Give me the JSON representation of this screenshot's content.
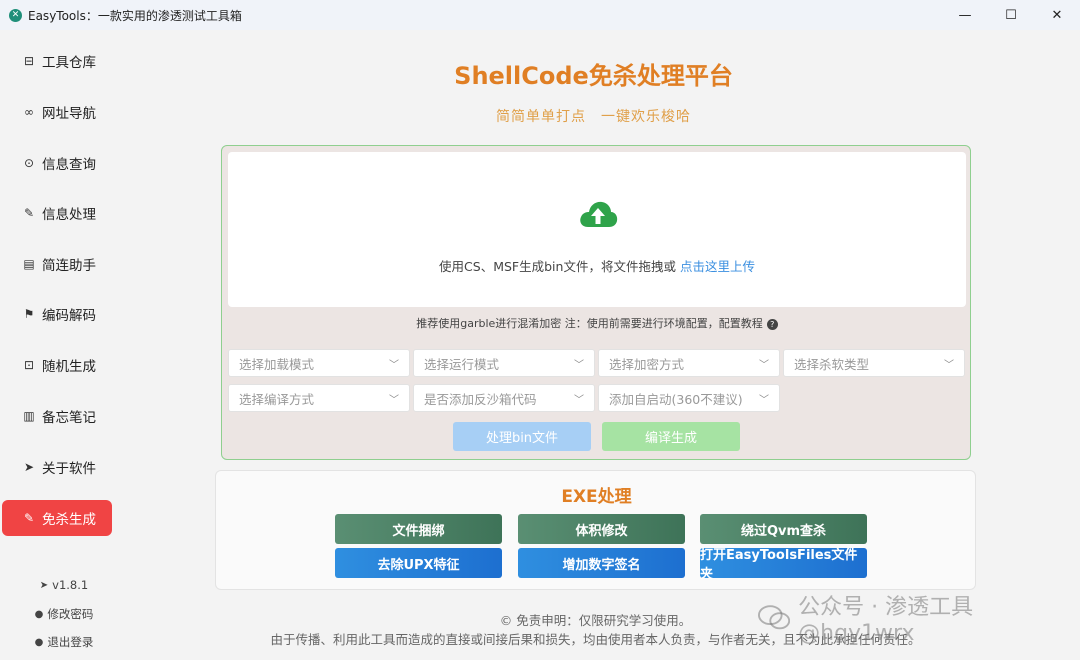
{
  "window": {
    "title": "EasyTools：一款实用的渗透测试工具箱",
    "minimize": "—",
    "maximize": "☐",
    "close": "✕"
  },
  "sidebar": {
    "items": [
      {
        "label": "工具仓库",
        "icon": "toolbox-icon",
        "glyph": "⊟"
      },
      {
        "label": "网址导航",
        "icon": "link-icon",
        "glyph": "∞"
      },
      {
        "label": "信息查询",
        "icon": "search-info-icon",
        "glyph": "⊙"
      },
      {
        "label": "信息处理",
        "icon": "edit-icon",
        "glyph": "✎"
      },
      {
        "label": "简连助手",
        "icon": "clipboard-icon",
        "glyph": "▤"
      },
      {
        "label": "编码解码",
        "icon": "flag-icon",
        "glyph": "⚑"
      },
      {
        "label": "随机生成",
        "icon": "gift-icon",
        "glyph": "⊡"
      },
      {
        "label": "备忘笔记",
        "icon": "notebook-icon",
        "glyph": "▥"
      },
      {
        "label": "关于软件",
        "icon": "send-icon",
        "glyph": "➤"
      },
      {
        "label": "免杀生成",
        "icon": "bug-icon",
        "glyph": "✎",
        "active": true
      }
    ],
    "footer": {
      "version": "v1.8.1",
      "change_password": "修改密码",
      "logout": "退出登录"
    }
  },
  "main": {
    "title": "ShellCode免杀处理平台",
    "subtitle": "简简单单打点　一键欢乐梭哈",
    "upload": {
      "icon": "upload-cloud-icon",
      "text": "使用CS、MSF生成bin文件，将文件拖拽或 ",
      "link": "点击这里上传"
    },
    "tip": "推荐使用garble进行混淆加密 注：使用前需要进行环境配置，配置教程",
    "selects": [
      {
        "placeholder": "选择加载模式"
      },
      {
        "placeholder": "选择运行模式"
      },
      {
        "placeholder": "选择加密方式"
      },
      {
        "placeholder": "选择杀软类型"
      },
      {
        "placeholder": "选择编译方式"
      },
      {
        "placeholder": "是否添加反沙箱代码"
      },
      {
        "placeholder": "添加自启动(360不建议)"
      }
    ],
    "process_button": "处理bin文件",
    "compile_button": "编译生成"
  },
  "exe": {
    "title": "EXE处理",
    "buttons": [
      "文件捆绑",
      "体积修改",
      "绕过Qvm查杀",
      "去除UPX特征",
      "增加数字签名",
      "打开EasyToolsFiles文件夹"
    ]
  },
  "disclaimer": {
    "line1": "© 免责申明：仅限研究学习使用。",
    "line2": "由于传播、利用此工具而造成的直接或间接后果和损失，均由使用者本人负责，与作者无关，且不为此承担任何责任。"
  },
  "watermark": "公众号 · 渗透工具 @hqy1wrx",
  "colors": {
    "accent_orange": "#e07f24",
    "active_red": "#f04444",
    "link_blue": "#3b8fe0",
    "green_btn": "#4f8466",
    "blue_btn": "#2080dc"
  }
}
